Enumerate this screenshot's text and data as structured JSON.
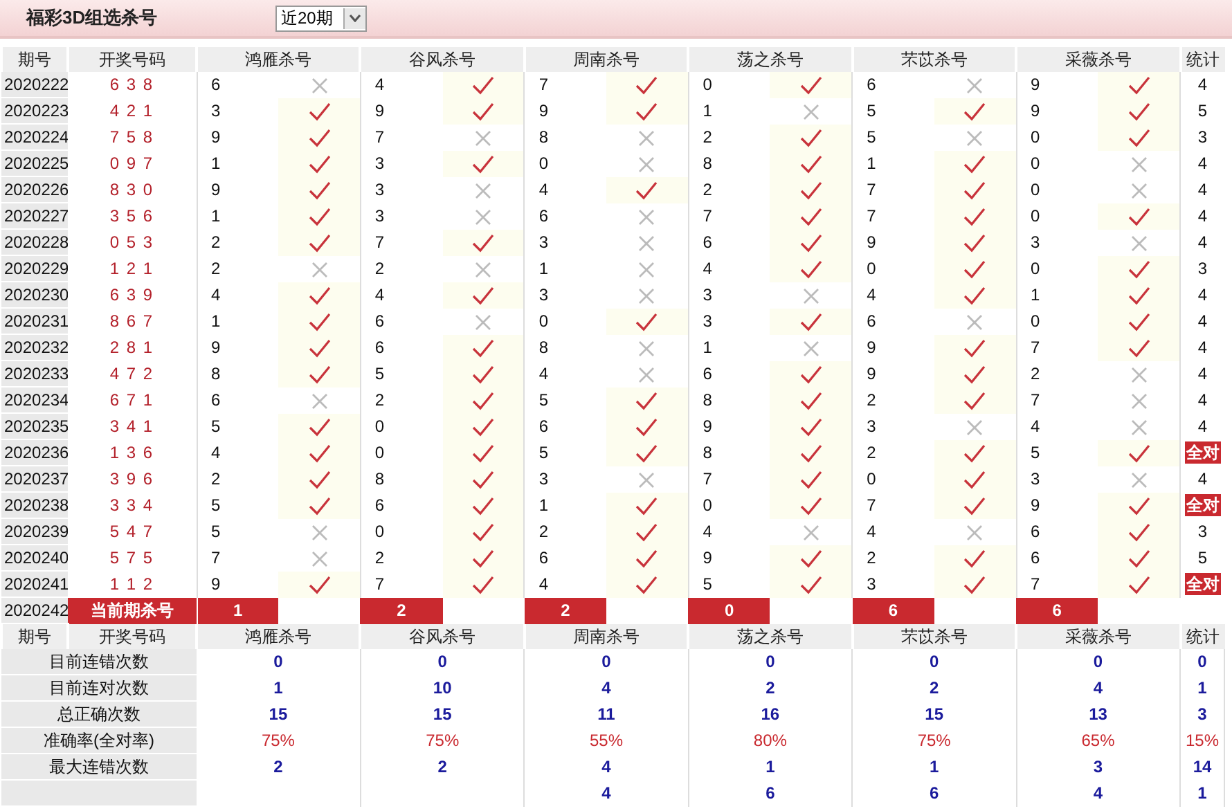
{
  "title": "福彩3D组选杀号",
  "period_select": {
    "value": "近20期"
  },
  "columns": [
    "期号",
    "开奖号码",
    "鸿雁杀号",
    "谷风杀号",
    "周南杀号",
    "荡之杀号",
    "芣苡杀号",
    "采薇杀号",
    "统计"
  ],
  "rows": [
    {
      "period": "2020222",
      "draw": "6 3 8",
      "kills": [
        {
          "digit": "6",
          "hit": false
        },
        {
          "digit": "4",
          "hit": true
        },
        {
          "digit": "7",
          "hit": true
        },
        {
          "digit": "0",
          "hit": true
        },
        {
          "digit": "6",
          "hit": false
        },
        {
          "digit": "9",
          "hit": true
        }
      ],
      "stat": {
        "kind": "count",
        "text": "4"
      }
    },
    {
      "period": "2020223",
      "draw": "4 2 1",
      "kills": [
        {
          "digit": "3",
          "hit": true
        },
        {
          "digit": "9",
          "hit": true
        },
        {
          "digit": "9",
          "hit": true
        },
        {
          "digit": "1",
          "hit": false
        },
        {
          "digit": "5",
          "hit": true
        },
        {
          "digit": "9",
          "hit": true
        }
      ],
      "stat": {
        "kind": "count",
        "text": "5"
      }
    },
    {
      "period": "2020224",
      "draw": "7 5 8",
      "kills": [
        {
          "digit": "9",
          "hit": true
        },
        {
          "digit": "7",
          "hit": false
        },
        {
          "digit": "8",
          "hit": false
        },
        {
          "digit": "2",
          "hit": true
        },
        {
          "digit": "5",
          "hit": false
        },
        {
          "digit": "0",
          "hit": true
        }
      ],
      "stat": {
        "kind": "count",
        "text": "3"
      }
    },
    {
      "period": "2020225",
      "draw": "0 9 7",
      "kills": [
        {
          "digit": "1",
          "hit": true
        },
        {
          "digit": "3",
          "hit": true
        },
        {
          "digit": "0",
          "hit": false
        },
        {
          "digit": "8",
          "hit": true
        },
        {
          "digit": "1",
          "hit": true
        },
        {
          "digit": "0",
          "hit": false
        }
      ],
      "stat": {
        "kind": "count",
        "text": "4"
      }
    },
    {
      "period": "2020226",
      "draw": "8 3 0",
      "kills": [
        {
          "digit": "9",
          "hit": true
        },
        {
          "digit": "3",
          "hit": false
        },
        {
          "digit": "4",
          "hit": true
        },
        {
          "digit": "2",
          "hit": true
        },
        {
          "digit": "7",
          "hit": true
        },
        {
          "digit": "0",
          "hit": false
        }
      ],
      "stat": {
        "kind": "count",
        "text": "4"
      }
    },
    {
      "period": "2020227",
      "draw": "3 5 6",
      "kills": [
        {
          "digit": "1",
          "hit": true
        },
        {
          "digit": "3",
          "hit": false
        },
        {
          "digit": "6",
          "hit": false
        },
        {
          "digit": "7",
          "hit": true
        },
        {
          "digit": "7",
          "hit": true
        },
        {
          "digit": "0",
          "hit": true
        }
      ],
      "stat": {
        "kind": "count",
        "text": "4"
      }
    },
    {
      "period": "2020228",
      "draw": "0 5 3",
      "kills": [
        {
          "digit": "2",
          "hit": true
        },
        {
          "digit": "7",
          "hit": true
        },
        {
          "digit": "3",
          "hit": false
        },
        {
          "digit": "6",
          "hit": true
        },
        {
          "digit": "9",
          "hit": true
        },
        {
          "digit": "3",
          "hit": false
        }
      ],
      "stat": {
        "kind": "count",
        "text": "4"
      }
    },
    {
      "period": "2020229",
      "draw": "1 2 1",
      "kills": [
        {
          "digit": "2",
          "hit": false
        },
        {
          "digit": "2",
          "hit": false
        },
        {
          "digit": "1",
          "hit": false
        },
        {
          "digit": "4",
          "hit": true
        },
        {
          "digit": "0",
          "hit": true
        },
        {
          "digit": "0",
          "hit": true
        }
      ],
      "stat": {
        "kind": "count",
        "text": "3"
      }
    },
    {
      "period": "2020230",
      "draw": "6 3 9",
      "kills": [
        {
          "digit": "4",
          "hit": true
        },
        {
          "digit": "4",
          "hit": true
        },
        {
          "digit": "3",
          "hit": false
        },
        {
          "digit": "3",
          "hit": false
        },
        {
          "digit": "4",
          "hit": true
        },
        {
          "digit": "1",
          "hit": true
        }
      ],
      "stat": {
        "kind": "count",
        "text": "4"
      }
    },
    {
      "period": "2020231",
      "draw": "8 6 7",
      "kills": [
        {
          "digit": "1",
          "hit": true
        },
        {
          "digit": "6",
          "hit": false
        },
        {
          "digit": "0",
          "hit": true
        },
        {
          "digit": "3",
          "hit": true
        },
        {
          "digit": "6",
          "hit": false
        },
        {
          "digit": "0",
          "hit": true
        }
      ],
      "stat": {
        "kind": "count",
        "text": "4"
      }
    },
    {
      "period": "2020232",
      "draw": "2 8 1",
      "kills": [
        {
          "digit": "9",
          "hit": true
        },
        {
          "digit": "6",
          "hit": true
        },
        {
          "digit": "8",
          "hit": false
        },
        {
          "digit": "1",
          "hit": false
        },
        {
          "digit": "9",
          "hit": true
        },
        {
          "digit": "7",
          "hit": true
        }
      ],
      "stat": {
        "kind": "count",
        "text": "4"
      }
    },
    {
      "period": "2020233",
      "draw": "4 7 2",
      "kills": [
        {
          "digit": "8",
          "hit": true
        },
        {
          "digit": "5",
          "hit": true
        },
        {
          "digit": "4",
          "hit": false
        },
        {
          "digit": "6",
          "hit": true
        },
        {
          "digit": "9",
          "hit": true
        },
        {
          "digit": "2",
          "hit": false
        }
      ],
      "stat": {
        "kind": "count",
        "text": "4"
      }
    },
    {
      "period": "2020234",
      "draw": "6 7 1",
      "kills": [
        {
          "digit": "6",
          "hit": false
        },
        {
          "digit": "2",
          "hit": true
        },
        {
          "digit": "5",
          "hit": true
        },
        {
          "digit": "8",
          "hit": true
        },
        {
          "digit": "2",
          "hit": true
        },
        {
          "digit": "7",
          "hit": false
        }
      ],
      "stat": {
        "kind": "count",
        "text": "4"
      }
    },
    {
      "period": "2020235",
      "draw": "3 4 1",
      "kills": [
        {
          "digit": "5",
          "hit": true
        },
        {
          "digit": "0",
          "hit": true
        },
        {
          "digit": "6",
          "hit": true
        },
        {
          "digit": "9",
          "hit": true
        },
        {
          "digit": "3",
          "hit": false
        },
        {
          "digit": "4",
          "hit": false
        }
      ],
      "stat": {
        "kind": "count",
        "text": "4"
      }
    },
    {
      "period": "2020236",
      "draw": "1 3 6",
      "kills": [
        {
          "digit": "4",
          "hit": true
        },
        {
          "digit": "0",
          "hit": true
        },
        {
          "digit": "5",
          "hit": true
        },
        {
          "digit": "8",
          "hit": true
        },
        {
          "digit": "2",
          "hit": true
        },
        {
          "digit": "5",
          "hit": true
        }
      ],
      "stat": {
        "kind": "all_hit",
        "text": "全对"
      }
    },
    {
      "period": "2020237",
      "draw": "3 9 6",
      "kills": [
        {
          "digit": "2",
          "hit": true
        },
        {
          "digit": "8",
          "hit": true
        },
        {
          "digit": "3",
          "hit": false
        },
        {
          "digit": "7",
          "hit": true
        },
        {
          "digit": "0",
          "hit": true
        },
        {
          "digit": "3",
          "hit": false
        }
      ],
      "stat": {
        "kind": "count",
        "text": "4"
      }
    },
    {
      "period": "2020238",
      "draw": "3 3 4",
      "kills": [
        {
          "digit": "5",
          "hit": true
        },
        {
          "digit": "6",
          "hit": true
        },
        {
          "digit": "1",
          "hit": true
        },
        {
          "digit": "0",
          "hit": true
        },
        {
          "digit": "7",
          "hit": true
        },
        {
          "digit": "9",
          "hit": true
        }
      ],
      "stat": {
        "kind": "all_hit",
        "text": "全对"
      }
    },
    {
      "period": "2020239",
      "draw": "5 4 7",
      "kills": [
        {
          "digit": "5",
          "hit": false
        },
        {
          "digit": "0",
          "hit": true
        },
        {
          "digit": "2",
          "hit": true
        },
        {
          "digit": "4",
          "hit": false
        },
        {
          "digit": "4",
          "hit": false
        },
        {
          "digit": "6",
          "hit": true
        }
      ],
      "stat": {
        "kind": "count",
        "text": "3"
      }
    },
    {
      "period": "2020240",
      "draw": "5 7 5",
      "kills": [
        {
          "digit": "7",
          "hit": false
        },
        {
          "digit": "2",
          "hit": true
        },
        {
          "digit": "6",
          "hit": true
        },
        {
          "digit": "9",
          "hit": true
        },
        {
          "digit": "2",
          "hit": true
        },
        {
          "digit": "6",
          "hit": true
        }
      ],
      "stat": {
        "kind": "count",
        "text": "5"
      }
    },
    {
      "period": "2020241",
      "draw": "1 1 2",
      "kills": [
        {
          "digit": "9",
          "hit": true
        },
        {
          "digit": "7",
          "hit": true
        },
        {
          "digit": "4",
          "hit": true
        },
        {
          "digit": "5",
          "hit": true
        },
        {
          "digit": "3",
          "hit": true
        },
        {
          "digit": "7",
          "hit": true
        }
      ],
      "stat": {
        "kind": "all_hit",
        "text": "全对"
      }
    }
  ],
  "current": {
    "period": "2020242",
    "label": "当前期杀号",
    "kills": [
      "1",
      "2",
      "2",
      "0",
      "6",
      "6"
    ]
  },
  "summary_columns": [
    "期号",
    "开奖号码",
    "鸿雁杀号",
    "谷风杀号",
    "周南杀号",
    "荡之杀号",
    "芣苡杀号",
    "采薇杀号",
    "统计"
  ],
  "summary": [
    {
      "label": "目前连错次数",
      "kind": "count",
      "values": [
        "0",
        "0",
        "0",
        "0",
        "0",
        "0",
        "0"
      ]
    },
    {
      "label": "目前连对次数",
      "kind": "count",
      "values": [
        "1",
        "10",
        "4",
        "2",
        "2",
        "4",
        "1"
      ]
    },
    {
      "label": "总正确次数",
      "kind": "count",
      "values": [
        "15",
        "15",
        "11",
        "16",
        "15",
        "13",
        "3"
      ]
    },
    {
      "label": "准确率(全对率)",
      "kind": "rate",
      "values": [
        "75%",
        "75%",
        "55%",
        "80%",
        "75%",
        "65%",
        "15%"
      ]
    },
    {
      "label": "最大连错次数",
      "kind": "count",
      "values": [
        "2",
        "2",
        "4",
        "1",
        "1",
        "3",
        "14"
      ]
    },
    {
      "kind": "count_tail",
      "values": [
        "4",
        "6",
        "6",
        "4",
        "1"
      ]
    }
  ]
}
